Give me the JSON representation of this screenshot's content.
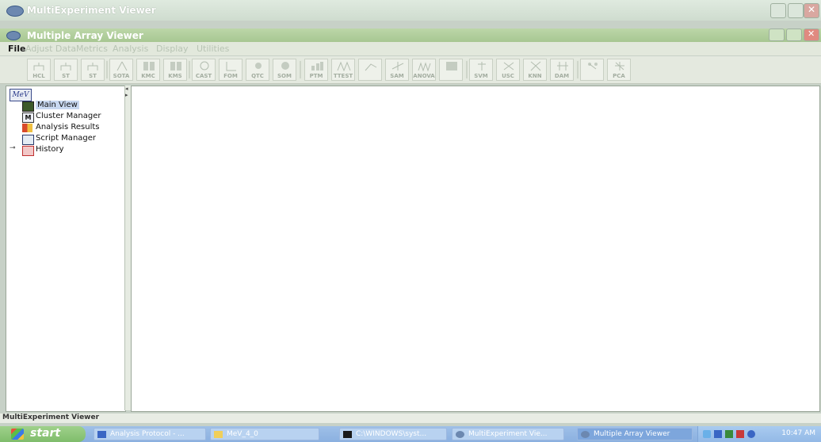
{
  "window": {
    "title": "MultiExperiment Viewer"
  },
  "inner_window": {
    "title": "Multiple Array Viewer"
  },
  "menu": [
    "File",
    "Adjust Data",
    "Metrics",
    "Analysis",
    "Display",
    "Utilities"
  ],
  "toolbar": [
    "HCL",
    "ST",
    "ST",
    "SOTA",
    "KMC",
    "KMS",
    "CAST",
    "FOM",
    "QTC",
    "SOM",
    "PTM",
    "TTEST",
    "SAM",
    "ANOVA",
    "SVM",
    "USC",
    "KNN",
    "DAM",
    "PCA"
  ],
  "tree": {
    "root": "MeV",
    "items": [
      {
        "label": "Main View",
        "icon": "main-view-icon",
        "selected": true
      },
      {
        "label": "Cluster Manager",
        "icon": "cluster-manager-icon"
      },
      {
        "label": "Analysis Results",
        "icon": "analysis-results-icon"
      },
      {
        "label": "Script Manager",
        "icon": "script-manager-icon"
      },
      {
        "label": "History",
        "icon": "history-icon"
      }
    ]
  },
  "status": "MultiExperiment Viewer",
  "taskbar": {
    "start": "start",
    "tasks": [
      "Analysis Protocol - ...",
      "MeV_4_0",
      "C:\\WINDOWS\\syst...",
      "MultiExperiment Vie...",
      "Multiple Array Viewer"
    ],
    "clock": "10:47 AM"
  },
  "colors": {
    "selected_item": "#c8d8f0",
    "taskbar": "#8bb0e0",
    "start_button": "#7fbd6b",
    "inner_title": "#a7c792"
  }
}
